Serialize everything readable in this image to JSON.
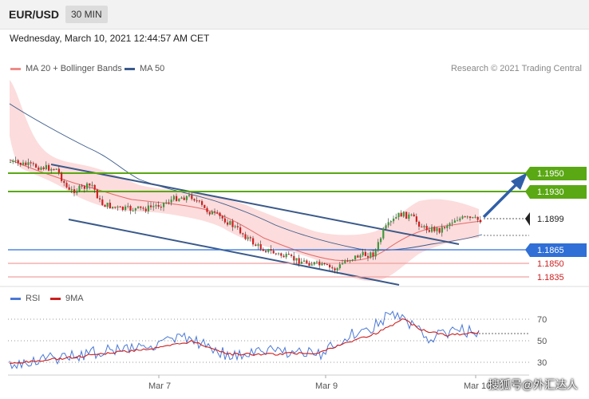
{
  "header": {
    "symbol": "EUR/USD",
    "timeframe": "30 MIN"
  },
  "datetime": "Wednesday, March 10, 2021 12:44:57 AM CET",
  "legend": {
    "items": [
      {
        "label": "MA 20 + Bollinger Bands",
        "color": "#f08a8a"
      },
      {
        "label": "MA 50",
        "color": "#3a5a8a"
      }
    ]
  },
  "copyright": "Research © 2021 Trading Central",
  "colors": {
    "green": "#5aa814",
    "blue": "#2f6fd6",
    "red": "#cc1f1f",
    "channel": "#3a5a8a",
    "bull": "#3c9a3c",
    "bear": "#d02020"
  },
  "levels": [
    {
      "value": "1.1950",
      "kind": "resistance"
    },
    {
      "value": "1.1930",
      "kind": "resistance"
    },
    {
      "value": "1.1899",
      "kind": "current"
    },
    {
      "value": "1.1865",
      "kind": "pivot"
    },
    {
      "value": "1.1850",
      "kind": "support"
    },
    {
      "value": "1.1835",
      "kind": "support"
    }
  ],
  "rsi": {
    "legend": [
      {
        "label": "RSI",
        "color": "#4a78d6"
      },
      {
        "label": "9MA",
        "color": "#cc1f1f"
      }
    ],
    "ticks": [
      "70",
      "50",
      "30"
    ]
  },
  "xaxis": {
    "labels": [
      "Mar 7",
      "Mar 9",
      "Mar 10"
    ]
  },
  "watermark": "搜狐号@外汇达人"
}
